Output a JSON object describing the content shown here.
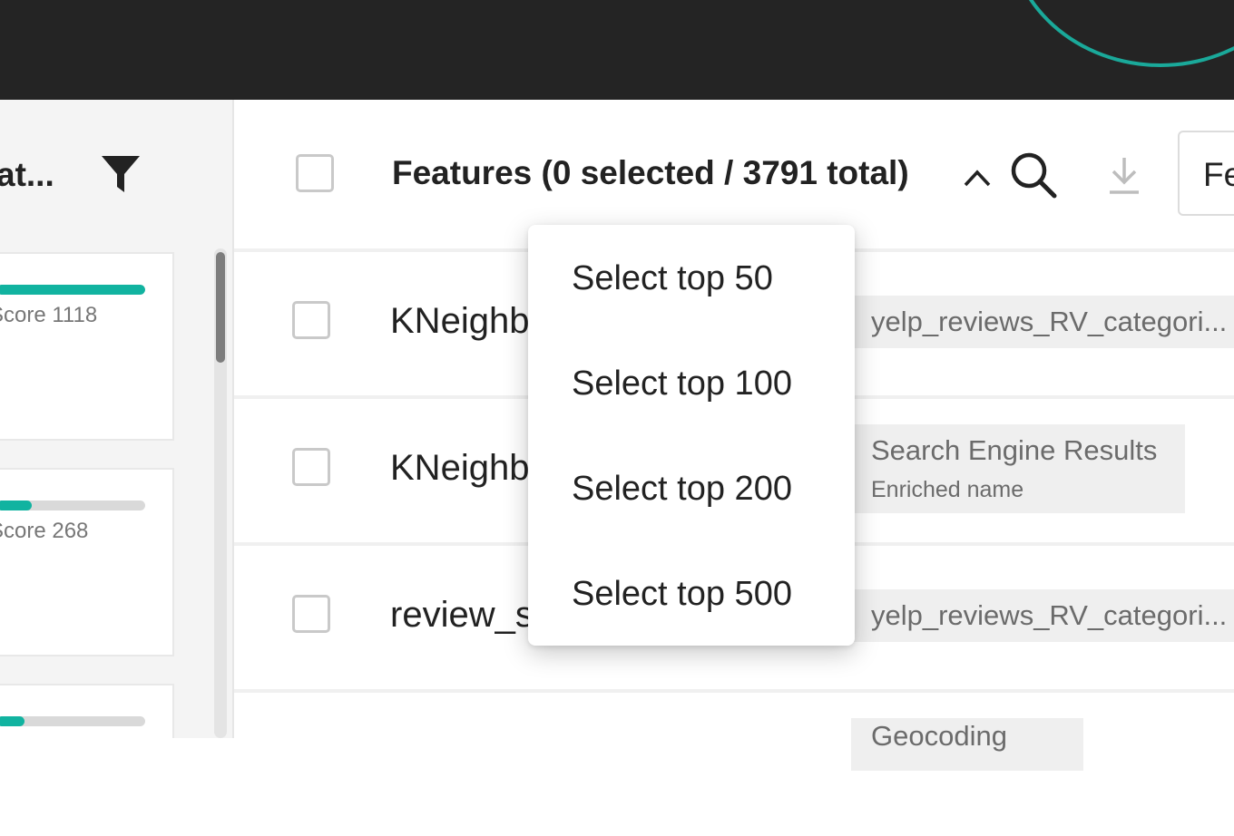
{
  "left_panel": {
    "title": "at...",
    "cards": [
      {
        "score_label": "Score 1118",
        "fill_fraction": 1.0
      },
      {
        "score_label": "Score 268",
        "fill_fraction": 0.24
      },
      {
        "score_label": "",
        "fill_fraction": 0.19
      }
    ]
  },
  "features_header": {
    "title": "Features (0 selected / 3791 total)",
    "right_box_text": "Fe"
  },
  "rows": [
    {
      "name": "KNeighb",
      "tag": "yelp_reviews_RV_categori...",
      "subtag": ""
    },
    {
      "name": "KNeighb",
      "tag": "Search Engine Results",
      "subtag": "Enriched name"
    },
    {
      "name": "review_s",
      "tag": "yelp_reviews_RV_categori...",
      "subtag": ""
    },
    {
      "name": "",
      "tag": "Geocoding",
      "subtag": ""
    }
  ],
  "dropdown": {
    "items": [
      "Select top 50",
      "Select top 100",
      "Select top 200",
      "Select top 500"
    ]
  },
  "icons": {
    "filter": "filter-icon",
    "sort": "chevron-up-icon",
    "search": "search-icon",
    "download": "download-icon"
  },
  "colors": {
    "topbar": "#242424",
    "accent": "#11b3a0"
  }
}
